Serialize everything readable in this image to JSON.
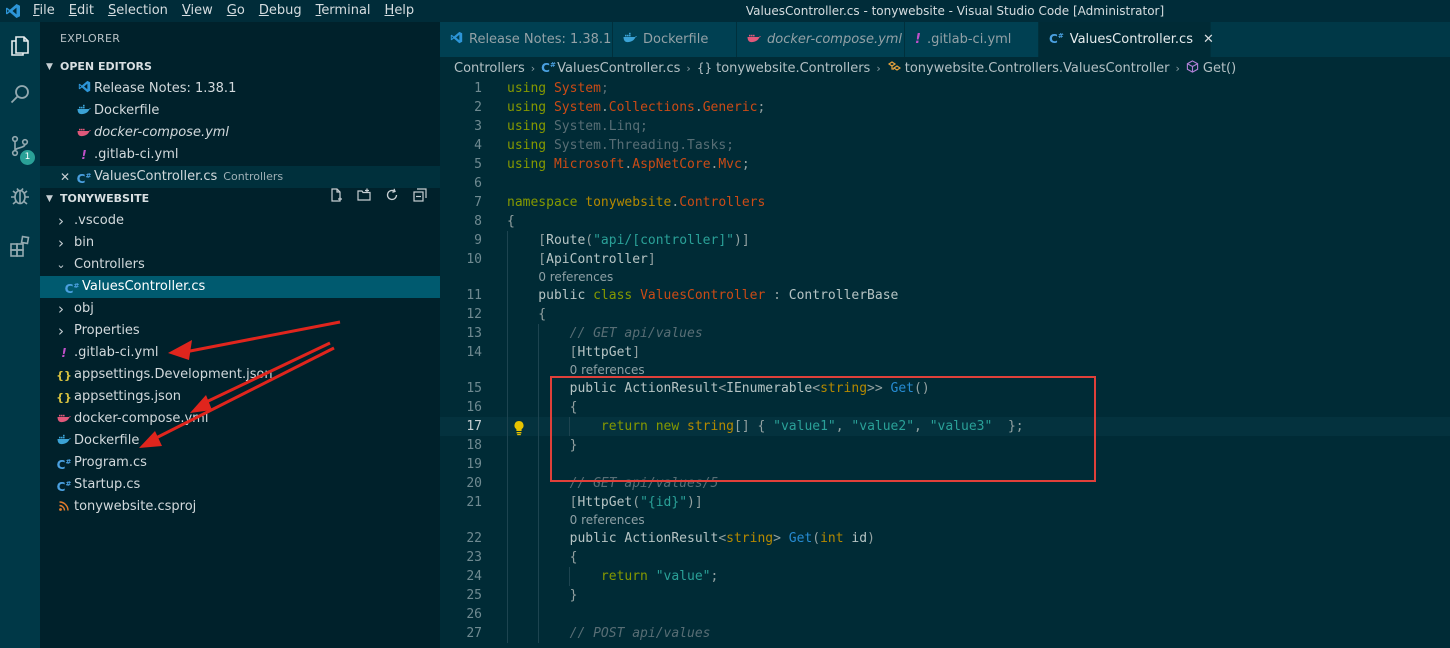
{
  "window": {
    "title": "ValuesController.cs - tonywebsite - Visual Studio Code [Administrator]",
    "menu": [
      "File",
      "Edit",
      "Selection",
      "View",
      "Go",
      "Debug",
      "Terminal",
      "Help"
    ],
    "menu_mnemonics": [
      "F",
      "E",
      "S",
      "V",
      "G",
      "D",
      "T",
      "H"
    ]
  },
  "activity_bar": {
    "items": [
      "explorer-icon",
      "search-icon",
      "source-control-icon",
      "debug-icon",
      "extensions-icon"
    ],
    "scm_badge": "1"
  },
  "sidebar": {
    "title": "EXPLORER",
    "open_editors": {
      "header": "OPEN EDITORS",
      "items": [
        {
          "name": "Release Notes: 1.38.1",
          "icon": "vscode-icon",
          "italic": false,
          "desc": ""
        },
        {
          "name": "Dockerfile",
          "icon": "docker-icon",
          "italic": false,
          "desc": ""
        },
        {
          "name": "docker-compose.yml",
          "icon": "docker-compose-icon",
          "italic": true,
          "desc": ""
        },
        {
          "name": ".gitlab-ci.yml",
          "icon": "yaml-icon",
          "italic": false,
          "desc": ""
        },
        {
          "name": "ValuesController.cs",
          "icon": "csharp-icon",
          "italic": false,
          "desc": "Controllers"
        }
      ]
    },
    "project": {
      "header": "TONYWEBSITE",
      "items": [
        {
          "name": ".vscode",
          "type": "folder"
        },
        {
          "name": "bin",
          "type": "folder"
        },
        {
          "name": "Controllers",
          "type": "folder-open"
        },
        {
          "name": "ValuesController.cs",
          "type": "csharp"
        },
        {
          "name": "obj",
          "type": "folder"
        },
        {
          "name": "Properties",
          "type": "folder"
        },
        {
          "name": ".gitlab-ci.yml",
          "type": "yaml"
        },
        {
          "name": "appsettings.Development.json",
          "type": "json"
        },
        {
          "name": "appsettings.json",
          "type": "json"
        },
        {
          "name": "docker-compose.yml",
          "type": "docker-compose"
        },
        {
          "name": "Dockerfile",
          "type": "docker"
        },
        {
          "name": "Program.cs",
          "type": "csharp"
        },
        {
          "name": "Startup.cs",
          "type": "csharp"
        },
        {
          "name": "tonywebsite.csproj",
          "type": "rss"
        }
      ]
    }
  },
  "tabs": [
    {
      "label": "Release Notes: 1.38.1",
      "icon": "vscode-icon",
      "italic": false,
      "active": false
    },
    {
      "label": "Dockerfile",
      "icon": "docker-icon",
      "italic": false,
      "active": false
    },
    {
      "label": "docker-compose.yml",
      "icon": "docker-compose-icon",
      "italic": true,
      "active": false
    },
    {
      "label": ".gitlab-ci.yml",
      "icon": "yaml-icon",
      "italic": false,
      "active": false
    },
    {
      "label": "ValuesController.cs",
      "icon": "csharp-icon",
      "italic": false,
      "active": true
    }
  ],
  "breadcrumbs": [
    "Controllers",
    "ValuesController.cs",
    "tonywebsite.Controllers",
    "tonywebsite.Controllers.ValuesController",
    "Get()"
  ],
  "editor": {
    "current_line": 17,
    "lines": [
      {
        "n": 1,
        "code": [
          [
            "k",
            "using "
          ],
          [
            "ns",
            "System"
          ],
          [
            "dim",
            ";"
          ]
        ]
      },
      {
        "n": 2,
        "code": [
          [
            "k",
            "using "
          ],
          [
            "ns",
            "System"
          ],
          [
            "p",
            "."
          ],
          [
            "ns",
            "Collections"
          ],
          [
            "p",
            "."
          ],
          [
            "ns",
            "Generic"
          ],
          [
            "p",
            ";"
          ]
        ]
      },
      {
        "n": 3,
        "code": [
          [
            "k",
            "using "
          ],
          [
            "dim",
            "System.Linq;"
          ]
        ]
      },
      {
        "n": 4,
        "code": [
          [
            "k",
            "using "
          ],
          [
            "dim",
            "System.Threading.Tasks;"
          ]
        ]
      },
      {
        "n": 5,
        "code": [
          [
            "k",
            "using "
          ],
          [
            "ns",
            "Microsoft"
          ],
          [
            "p",
            "."
          ],
          [
            "ns",
            "AspNetCore"
          ],
          [
            "p",
            "."
          ],
          [
            "ns",
            "Mvc"
          ],
          [
            "p",
            ";"
          ]
        ]
      },
      {
        "n": 6,
        "code": []
      },
      {
        "n": 7,
        "code": [
          [
            "k",
            "namespace "
          ],
          [
            "t",
            "tonywebsite"
          ],
          [
            "p",
            "."
          ],
          [
            "ns",
            "Controllers"
          ]
        ]
      },
      {
        "n": 8,
        "code": [
          [
            "p",
            "{"
          ]
        ]
      },
      {
        "n": 9,
        "code": [
          [
            "p",
            "    ["
          ],
          [
            "w",
            "Route"
          ],
          [
            "p",
            "("
          ],
          [
            "s",
            "\"api/[controller]\""
          ],
          [
            "p",
            ")]"
          ]
        ]
      },
      {
        "n": 10,
        "code": [
          [
            "p",
            "    ["
          ],
          [
            "w",
            "ApiController"
          ],
          [
            "p",
            "]"
          ]
        ],
        "lens_after": "0 references"
      },
      {
        "n": 11,
        "code": [
          [
            "w",
            "    public "
          ],
          [
            "k",
            "class "
          ],
          [
            "ns",
            "ValuesController"
          ],
          [
            "p",
            " : "
          ],
          [
            "w",
            "ControllerBase"
          ]
        ]
      },
      {
        "n": 12,
        "code": [
          [
            "p",
            "    {"
          ]
        ]
      },
      {
        "n": 13,
        "code": [
          [
            "c",
            "        // GET api/values"
          ]
        ]
      },
      {
        "n": 14,
        "code": [
          [
            "p",
            "        ["
          ],
          [
            "w",
            "HttpGet"
          ],
          [
            "p",
            "]"
          ]
        ],
        "lens_after": "0 references"
      },
      {
        "n": 15,
        "code": [
          [
            "w",
            "        public ActionResult"
          ],
          [
            "p",
            "<"
          ],
          [
            "w",
            "IEnumerable"
          ],
          [
            "p",
            "<"
          ],
          [
            "t",
            "string"
          ],
          [
            "p",
            ">> "
          ],
          [
            "f",
            "Get"
          ],
          [
            "p",
            "()"
          ]
        ]
      },
      {
        "n": 16,
        "code": [
          [
            "p",
            "        {"
          ]
        ]
      },
      {
        "n": 17,
        "code": [
          [
            "k",
            "            return "
          ],
          [
            "k",
            "new "
          ],
          [
            "t",
            "string"
          ],
          [
            "p",
            "[] { "
          ],
          [
            "s",
            "\"value1\""
          ],
          [
            "p",
            ", "
          ],
          [
            "s",
            "\"value2\""
          ],
          [
            "p",
            ", "
          ],
          [
            "s",
            "\"value3\""
          ],
          [
            "p",
            "  };"
          ]
        ]
      },
      {
        "n": 18,
        "code": [
          [
            "p",
            "        }"
          ]
        ]
      },
      {
        "n": 19,
        "code": []
      },
      {
        "n": 20,
        "code": [
          [
            "c",
            "        // GET api/values/5"
          ]
        ]
      },
      {
        "n": 21,
        "code": [
          [
            "p",
            "        ["
          ],
          [
            "w",
            "HttpGet"
          ],
          [
            "p",
            "("
          ],
          [
            "s",
            "\"{id}\""
          ],
          [
            "p",
            ")]"
          ]
        ],
        "lens_after": "0 references"
      },
      {
        "n": 22,
        "code": [
          [
            "w",
            "        public ActionResult"
          ],
          [
            "p",
            "<"
          ],
          [
            "t",
            "string"
          ],
          [
            "p",
            "> "
          ],
          [
            "f",
            "Get"
          ],
          [
            "p",
            "("
          ],
          [
            "t",
            "int "
          ],
          [
            "w",
            "id"
          ],
          [
            "p",
            ")"
          ]
        ]
      },
      {
        "n": 23,
        "code": [
          [
            "p",
            "        {"
          ]
        ]
      },
      {
        "n": 24,
        "code": [
          [
            "k",
            "            return "
          ],
          [
            "s",
            "\"value\""
          ],
          [
            "p",
            ";"
          ]
        ]
      },
      {
        "n": 25,
        "code": [
          [
            "p",
            "        }"
          ]
        ]
      },
      {
        "n": 26,
        "code": []
      },
      {
        "n": 27,
        "code": [
          [
            "c",
            "        // POST api/values"
          ]
        ]
      }
    ]
  },
  "annotations": {
    "box_color": "#e0403a",
    "arrow_color": "#e0251d",
    "arrow_targets": [
      ".gitlab-ci.yml",
      "docker-compose.yml",
      "Dockerfile"
    ]
  },
  "colors": {
    "background": "#002b36",
    "sidebar": "#00212b",
    "activity_bar": "#003847",
    "selection": "#005a6f"
  }
}
